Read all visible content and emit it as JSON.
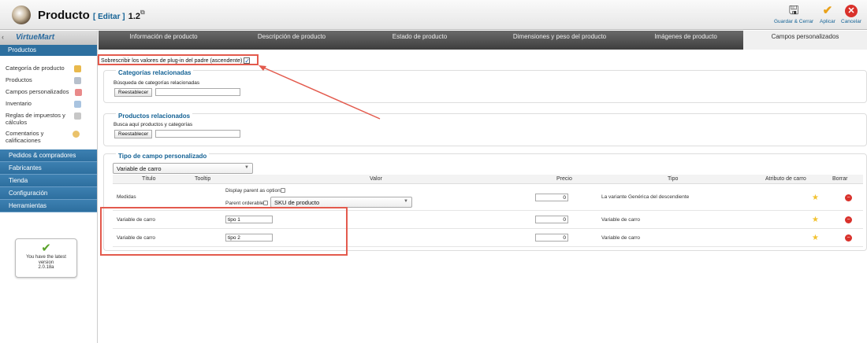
{
  "header": {
    "title": "Producto",
    "edit_label": "[ Editar ]",
    "version": "1.2",
    "buttons": {
      "save_close": "Guardar & Cerrar",
      "apply": "Aplicar",
      "cancel": "Cancelar"
    }
  },
  "sidebar": {
    "logo": "VirtueMart",
    "section_title": "Productos",
    "items": [
      {
        "label": "Categoría de producto",
        "icon": "folder-icon"
      },
      {
        "label": "Productos",
        "icon": "box-icon"
      },
      {
        "label": "Campos personalizados",
        "icon": "puzzle-icon"
      },
      {
        "label": "Inventario",
        "icon": "chart-icon"
      },
      {
        "label": "Reglas de impuestos y cálculos",
        "icon": "calculator-icon"
      },
      {
        "label": "Comentarios y calificaciones",
        "icon": "comment-icon"
      }
    ],
    "sections": [
      "Pedidos & compradores",
      "Fabricantes",
      "Tienda",
      "Configuración",
      "Herramientas"
    ],
    "version_box": {
      "line1": "You have the latest",
      "line2": "version",
      "line3": "2.0.18a"
    }
  },
  "tabs": [
    "Información de producto",
    "Descripción de producto",
    "Estado de producto",
    "Dimensiones y peso del producto",
    "Imágenes de producto",
    "Campos personalizados"
  ],
  "override_label": "Sobrescribir los valores de plug-in del padre (ascendente)",
  "related_categories": {
    "title": "Categorías relacionadas",
    "search_label": "Búsqueda de categorías relacionadas",
    "reset_label": "Reestablecer"
  },
  "related_products": {
    "title": "Productos relacionados",
    "search_label": "Busca aquí productos y categorías",
    "reset_label": "Reestablecer"
  },
  "custom_field": {
    "title": "Tipo de campo personalizado",
    "selected_type": "Variable de carro",
    "columns": [
      "Título",
      "Tooltip",
      "Valor",
      "Precio",
      "Tipo",
      "Atributo de carro",
      "Borrar"
    ],
    "rows": [
      {
        "title": "Medidas",
        "display_parent_label": "Display parent as option",
        "parent_orderable_label": "Parent orderable",
        "select_value": "SKU de producto",
        "price": "0",
        "type": "La variante Genérica del descendiente"
      },
      {
        "title": "Variable de carro",
        "value": "tipo 1",
        "price": "0",
        "type": "Variable de carro"
      },
      {
        "title": "Variable de carro",
        "value": "tipo 2",
        "price": "0",
        "type": "Variable de carro"
      }
    ]
  },
  "colors": {
    "accent": "#146295",
    "sidebar_blue": "#2d6f9f",
    "annotation_red": "#e35a4d"
  }
}
